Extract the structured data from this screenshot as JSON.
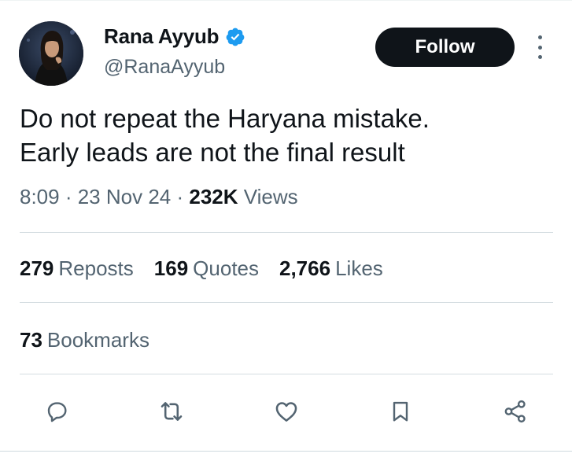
{
  "author": {
    "name": "Rana Ayyub",
    "handle": "@RanaAyyub",
    "verified_icon": "verified-badge-icon",
    "avatar_icon": "avatar"
  },
  "follow_label": "Follow",
  "more_icon": "more-vertical-icon",
  "tweet": {
    "line1": "Do not repeat the Haryana mistake.",
    "line2": "Early leads are not the final result"
  },
  "meta": {
    "time": "8:09",
    "sep1": " · ",
    "date": "23 Nov 24",
    "sep2": " · ",
    "views_count": "232K",
    "views_label": "Views"
  },
  "stats": {
    "reposts_count": "279",
    "reposts_label": "Reposts",
    "quotes_count": "169",
    "quotes_label": "Quotes",
    "likes_count": "2,766",
    "likes_label": "Likes",
    "bookmarks_count": "73",
    "bookmarks_label": "Bookmarks"
  },
  "actions": [
    "reply-icon",
    "repost-icon",
    "like-icon",
    "bookmark-icon",
    "share-icon"
  ],
  "colors": {
    "text_primary": "#0f1419",
    "text_secondary": "#536471",
    "verified_blue": "#1d9bf0",
    "follow_bg": "#0f1419",
    "divider": "#d5dde1"
  }
}
